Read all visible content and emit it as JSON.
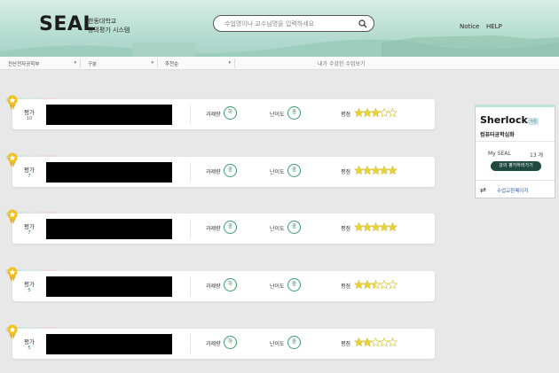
{
  "header": {
    "logo": "SEAL",
    "logo_sub_1": "한동대학교",
    "logo_sub_2": "강의평가 시스템",
    "search_placeholder": "수업명이나 교수님명을 입력하세요",
    "nav_notice": "Notice",
    "nav_help": "HELP"
  },
  "filters": {
    "department": "전산전자공학부",
    "category": "구분",
    "sort": "추천순",
    "my_courses_link": "내가 수강한 수업보기"
  },
  "courses": [
    {
      "rating_label": "평가",
      "rating_count": "10",
      "workload_label": "과제량",
      "workload": "하",
      "difficulty_label": "난이도",
      "difficulty": "중",
      "stars_label": "평점",
      "stars": 3
    },
    {
      "rating_label": "평가",
      "rating_count": "7",
      "workload_label": "과제량",
      "workload": "중",
      "difficulty_label": "난이도",
      "difficulty": "중",
      "stars_label": "평점",
      "stars": 5
    },
    {
      "rating_label": "평가",
      "rating_count": "7",
      "workload_label": "과제량",
      "workload": "중",
      "difficulty_label": "난이도",
      "difficulty": "중",
      "stars_label": "평점",
      "stars": 5
    },
    {
      "rating_label": "평가",
      "rating_count": "5",
      "workload_label": "과제량",
      "workload": "하",
      "difficulty_label": "난이도",
      "difficulty": "중",
      "stars_label": "평점",
      "stars": 2.5
    },
    {
      "rating_label": "평가",
      "rating_count": "5",
      "workload_label": "과제량",
      "workload": "하",
      "difficulty_label": "난이도",
      "difficulty": "중",
      "stars_label": "평점",
      "stars": 2
    }
  ],
  "profile": {
    "name": "Sherlock",
    "edit": "수정",
    "major": "컴퓨터공학심화",
    "my_seal_label": "My SEAL",
    "my_seal_count": "13 개",
    "write_button": "강의 평가하러가기",
    "cart_link": "수업교환페이지"
  },
  "colors": {
    "accent_green": "#3d9b6a",
    "dark_button": "#1f4a3d",
    "star": "#e8d23a",
    "header_mint": "#b9ded2"
  },
  "icons": {
    "search": "magnifier-icon",
    "badge": "star-medal-icon",
    "cart": "swap-arrows-icon"
  }
}
